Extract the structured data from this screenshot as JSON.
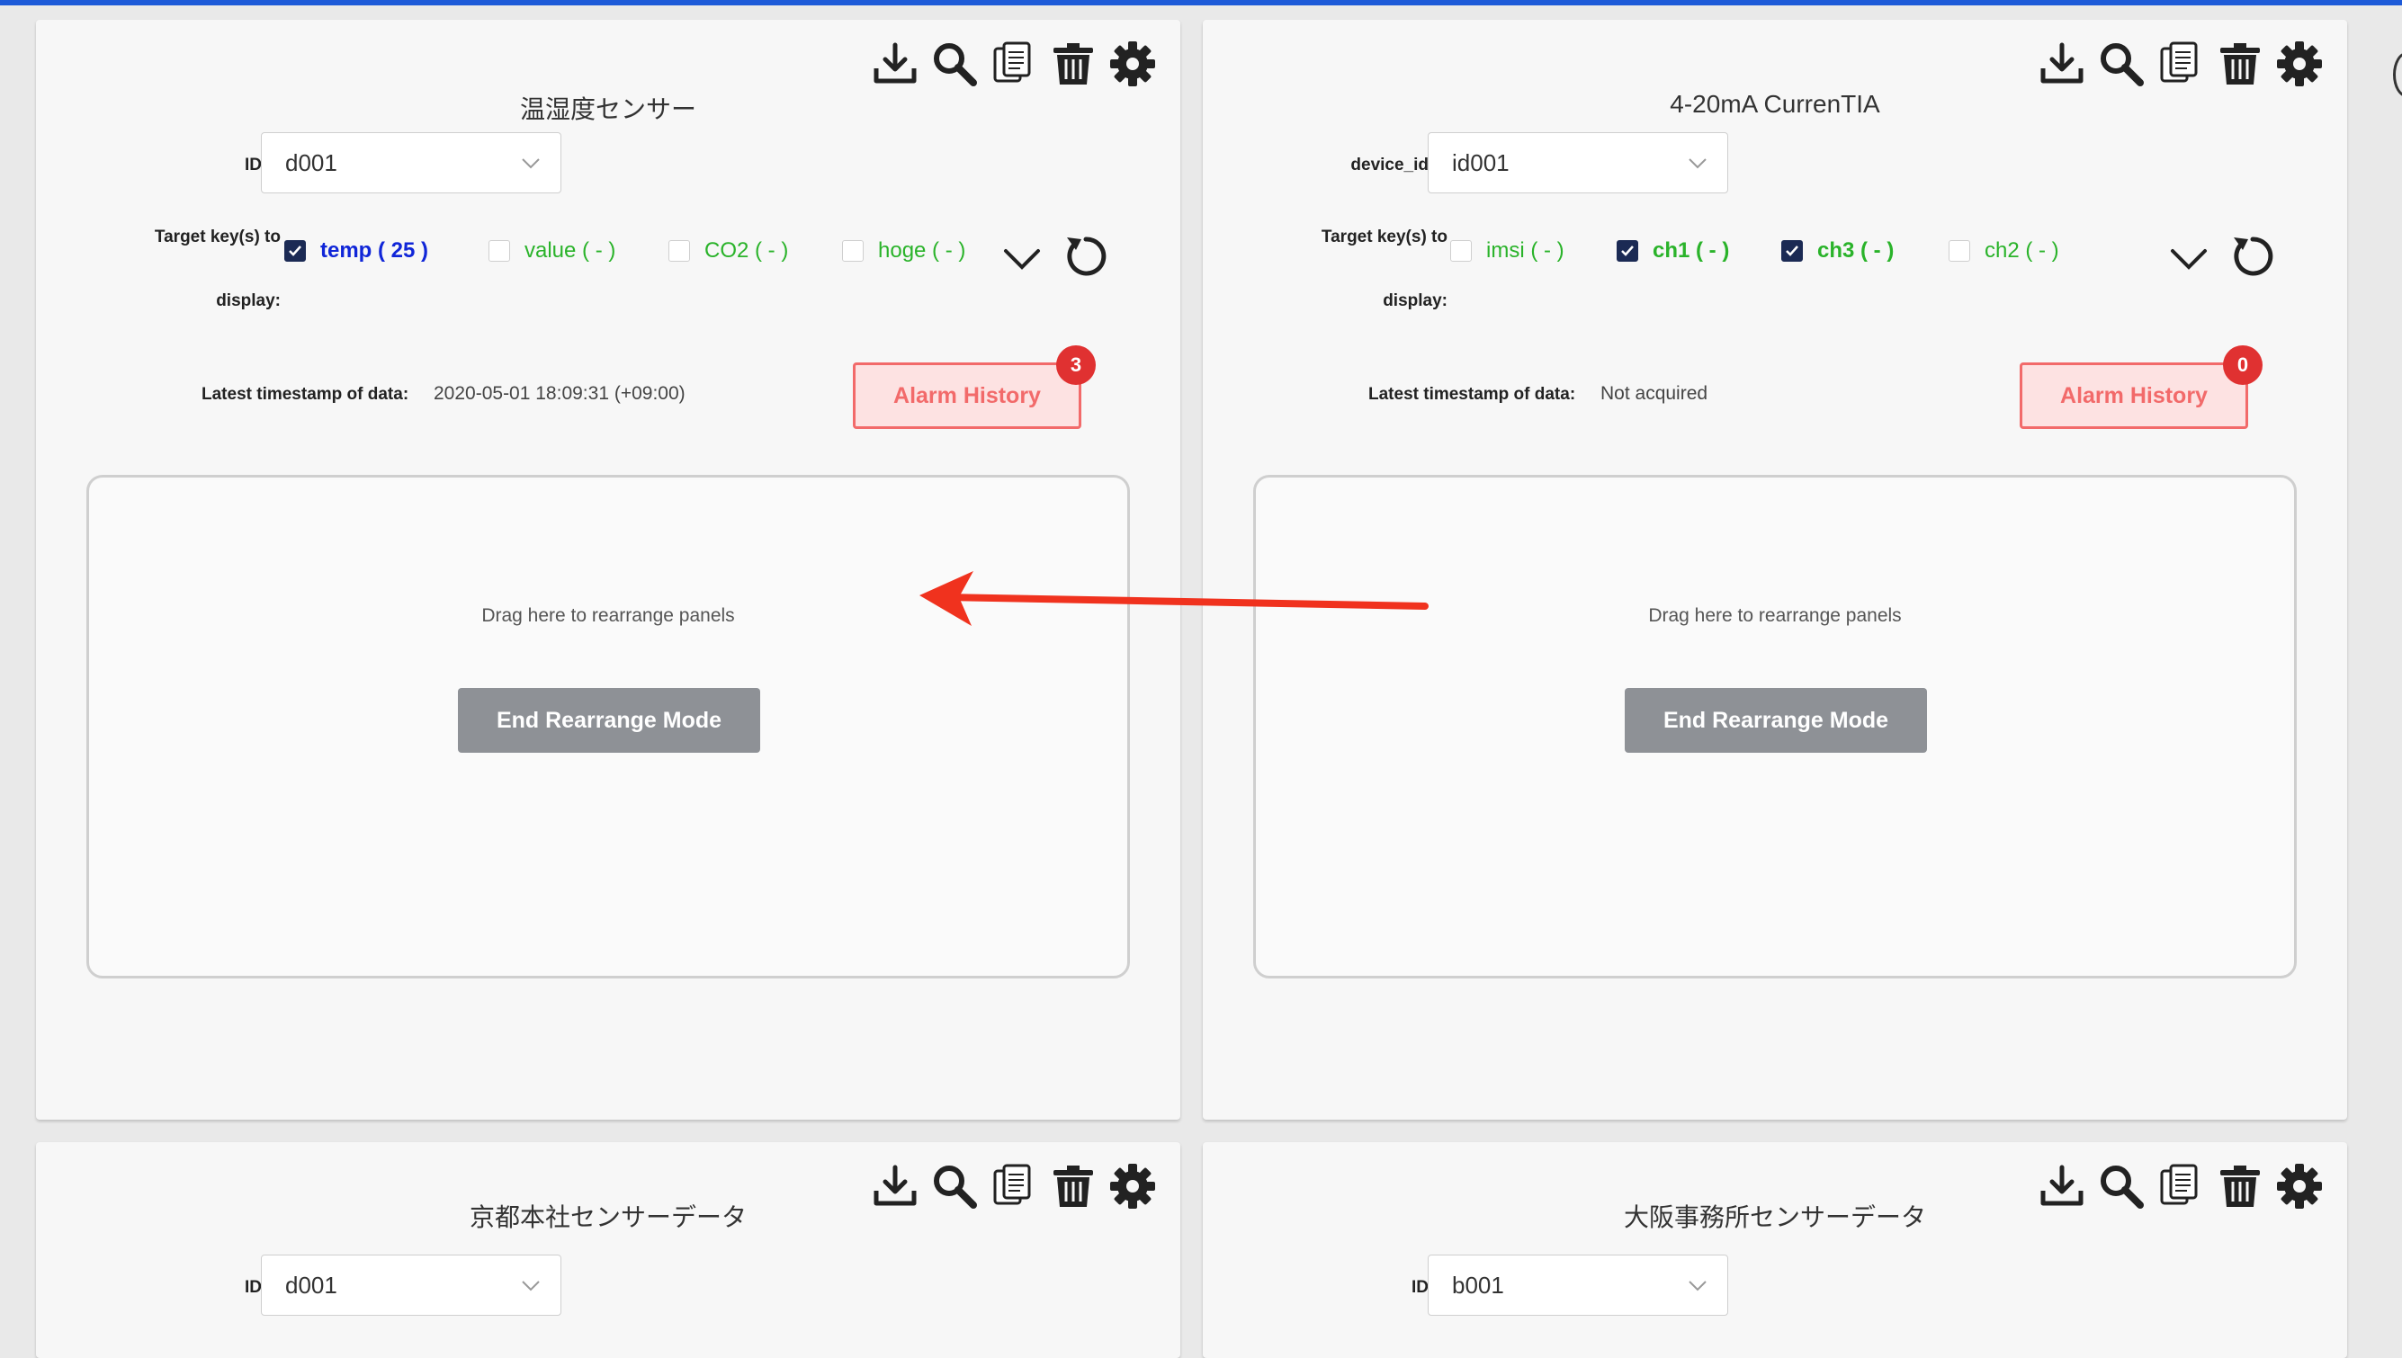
{
  "panels": [
    {
      "title": "温湿度センサー",
      "id_label": "ID：",
      "id_value": "d001",
      "target_label_1": "Target key(s) to",
      "target_label_2": "display:",
      "keys": [
        {
          "label": "temp ( 25 )",
          "checked": true
        },
        {
          "label": "value ( - )",
          "checked": false
        },
        {
          "label": "CO2 ( - )",
          "checked": false
        },
        {
          "label": "hoge ( - )",
          "checked": false
        }
      ],
      "timestamp_label": "Latest timestamp of data:",
      "timestamp_value": "2020-05-01 18:09:31 (+09:00)",
      "alarm_label": "Alarm History",
      "alarm_count": "3",
      "drop_text": "Drag here to rearrange panels",
      "end_button": "End Rearrange Mode"
    },
    {
      "title": "4-20mA CurrenTIA",
      "id_label": "device_id：",
      "id_value": "id001",
      "target_label_1": "Target key(s) to",
      "target_label_2": "display:",
      "keys": [
        {
          "label": "imsi ( - )",
          "checked": false
        },
        {
          "label": "ch1 ( - )",
          "checked": true
        },
        {
          "label": "ch3 ( - )",
          "checked": true
        },
        {
          "label": "ch2 ( - )",
          "checked": false
        }
      ],
      "timestamp_label": "Latest timestamp of data:",
      "timestamp_value": "Not acquired",
      "alarm_label": "Alarm History",
      "alarm_count": "0",
      "drop_text": "Drag here to rearrange panels",
      "end_button": "End Rearrange Mode"
    },
    {
      "title": "京都本社センサーデータ",
      "id_label": "ID：",
      "id_value": "d001"
    },
    {
      "title": "大阪事務所センサーデータ",
      "id_label": "ID：",
      "id_value": "b001"
    }
  ],
  "toolbar_icons": [
    "download-icon",
    "search-icon",
    "copy-icon",
    "trash-icon",
    "gear-icon"
  ],
  "colors": {
    "topbar": "#1d5ad8",
    "key_active_blue": "#1026d8",
    "key_green": "#2ab32a",
    "alarm_red": "#f26a6a",
    "badge_red": "#e03131",
    "checkbox_checked": "#1b2a54",
    "end_button_gray": "#8e9196",
    "annotation_arrow": "#f0321e"
  }
}
